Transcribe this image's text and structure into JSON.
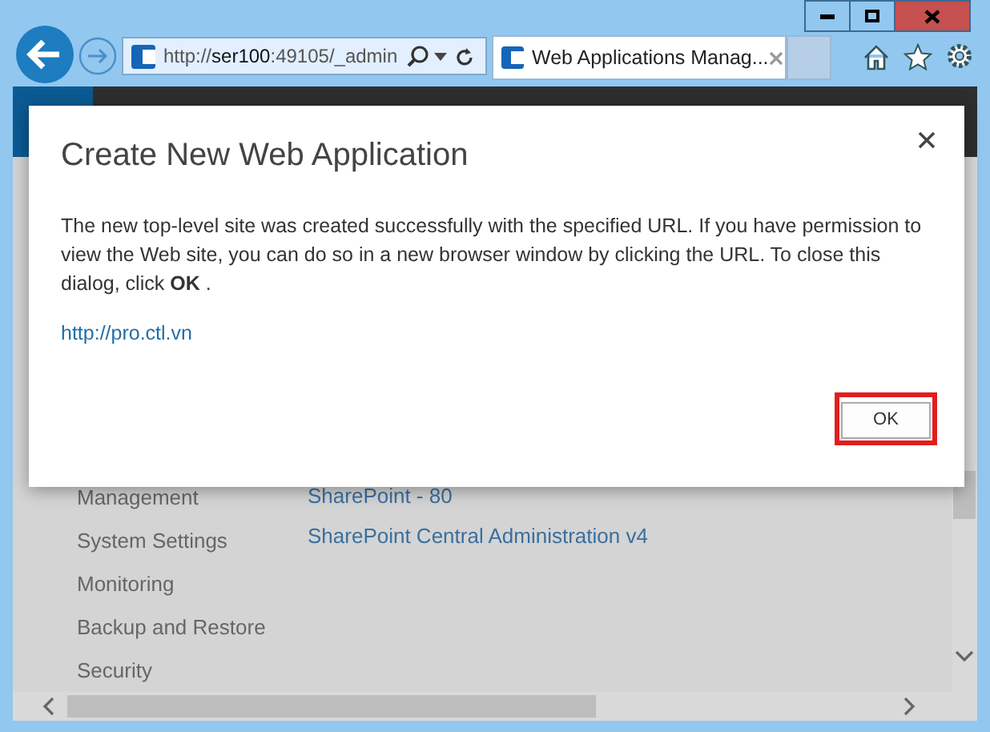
{
  "browser": {
    "address": {
      "scheme": "http://",
      "host": "ser100",
      "rest": ":49105/_admin"
    },
    "tabs": [
      {
        "label": "Web Applications Manag...",
        "selected": true
      }
    ]
  },
  "page": {
    "nav_items": [
      "Management",
      "System Settings",
      "Monitoring",
      "Backup and Restore",
      "Security"
    ],
    "links": [
      "SharePoint - 80",
      "SharePoint Central Administration v4"
    ]
  },
  "dialog": {
    "title": "Create New Web Application",
    "message": "The new top-level site was created successfully with the specified URL. If you have permission to view the Web site, you can do so in a new browser window by clicking the URL. To close this dialog, click **OK** .",
    "link": "http://pro.ctl.vn",
    "button": "OK"
  }
}
